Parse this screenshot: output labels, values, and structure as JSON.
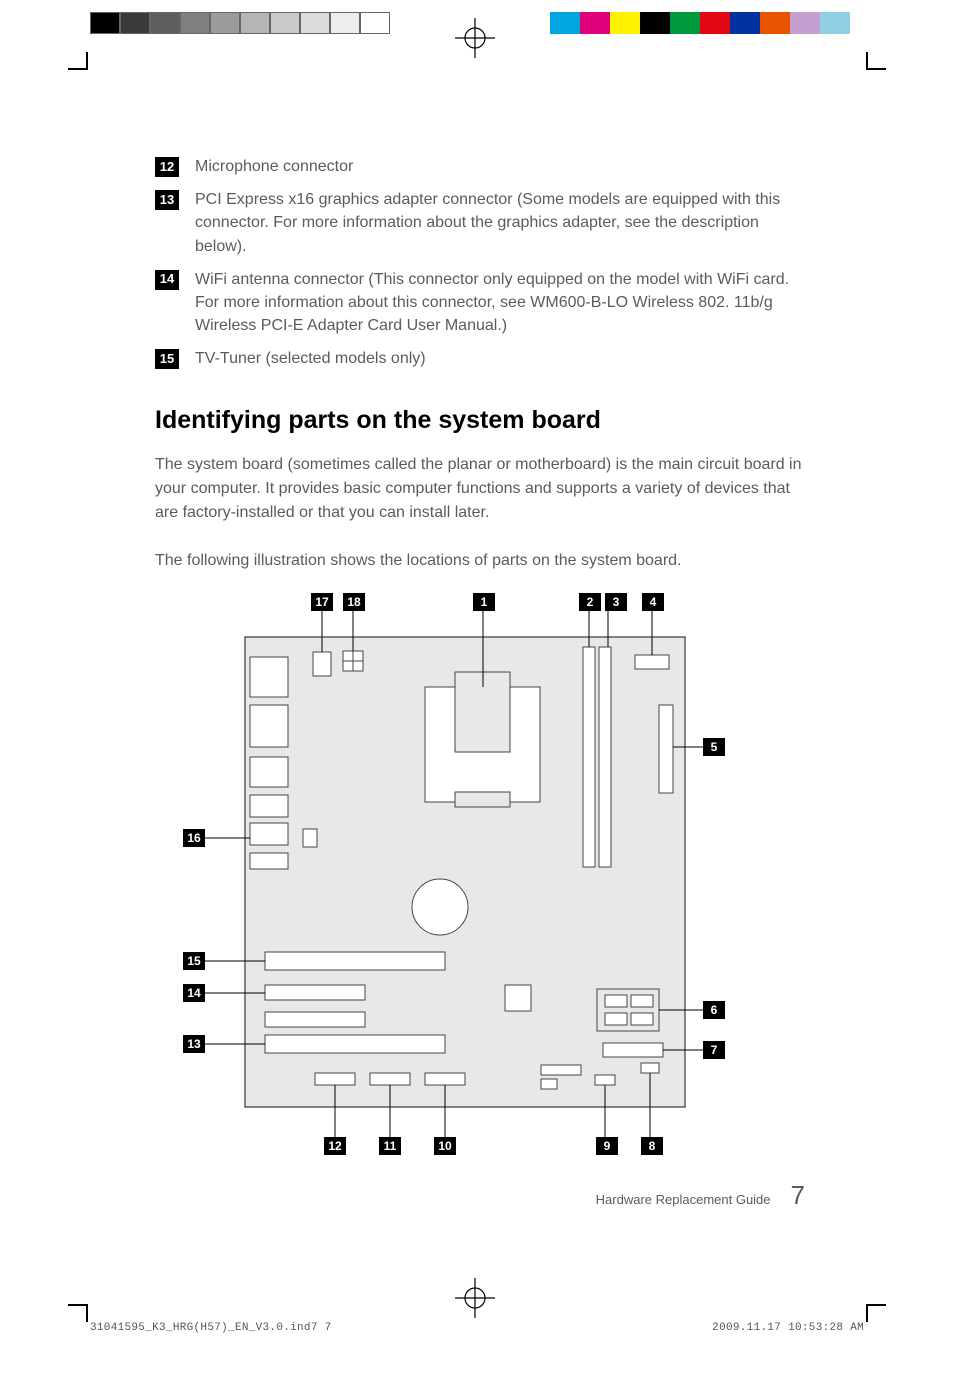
{
  "callouts": {
    "c12": {
      "num": "12",
      "text": "Microphone connector"
    },
    "c13": {
      "num": "13",
      "text": "PCI Express x16 graphics adapter connector (Some models are equipped with this connector. For more information about the graphics adapter, see the description below)."
    },
    "c14": {
      "num": "14",
      "text": "WiFi antenna connector (This connector only equipped on the model with WiFi card. For more information about this connector, see WM600-B-LO Wireless 802. 11b/g Wireless PCI-E Adapter Card User Manual.)"
    },
    "c15": {
      "num": "15",
      "text": "TV-Tuner (selected models only)"
    }
  },
  "section": {
    "heading": "Identifying parts on the system board",
    "para1": "The system board (sometimes called the planar or motherboard) is the main circuit board in your computer. It provides basic computer functions and supports a variety of devices that are factory-installed or that you can install later.",
    "para2": "The following illustration shows the locations of parts on the system board."
  },
  "diagram_labels": {
    "l1": "1",
    "l2": "2",
    "l3": "3",
    "l4": "4",
    "l5": "5",
    "l6": "6",
    "l7": "7",
    "l8": "8",
    "l9": "9",
    "l10": "10",
    "l11": "11",
    "l12": "12",
    "l13": "13",
    "l14": "14",
    "l15": "15",
    "l16": "16",
    "l17": "17",
    "l18": "18"
  },
  "footer": {
    "guide": "Hardware Replacement Guide",
    "page": "7"
  },
  "imprint": {
    "file": "31041595_K3_HRG(H57)_EN_V3.0.ind7   7",
    "datetime": "2009.11.17   10:53:28 AM"
  },
  "printer": {
    "gray_shades": [
      "#000000",
      "#3a3a3a",
      "#5e5e5e",
      "#808080",
      "#9c9c9c",
      "#b5b5b5",
      "#c9c9c9",
      "#dcdcdc",
      "#eeeeee",
      "#ffffff"
    ],
    "colors": [
      "#00a6e0",
      "#e0007a",
      "#fff200",
      "#000000",
      "#00983a",
      "#e30613",
      "#0033a0",
      "#e85400",
      "#c59fd1",
      "#8fd0e6"
    ]
  }
}
